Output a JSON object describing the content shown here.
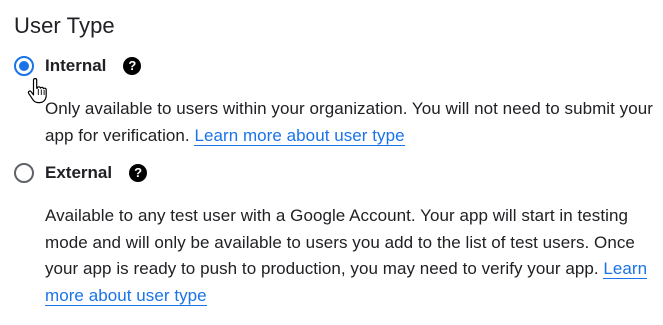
{
  "title": "User Type",
  "options": [
    {
      "label": "Internal",
      "selected": true,
      "help_icon": "help-circle-icon",
      "description": "Only available to users within your organization. You will not need to submit your app for verification.",
      "link_text": "Learn more about user type"
    },
    {
      "label": "External",
      "selected": false,
      "help_icon": "help-circle-icon",
      "description": "Available to any test user with a Google Account. Your app will start in testing mode and will only be available to users you add to the list of test users. Once your app is ready to push to production, you may need to verify your app.",
      "link_text": "Learn more about user type"
    }
  ],
  "help_glyph": "?",
  "cursor_icon": "hand-pointer-icon",
  "colors": {
    "accent": "#1a73e8",
    "text": "#202124",
    "radio_border": "#5f6368",
    "help_icon_bg": "#000000"
  }
}
